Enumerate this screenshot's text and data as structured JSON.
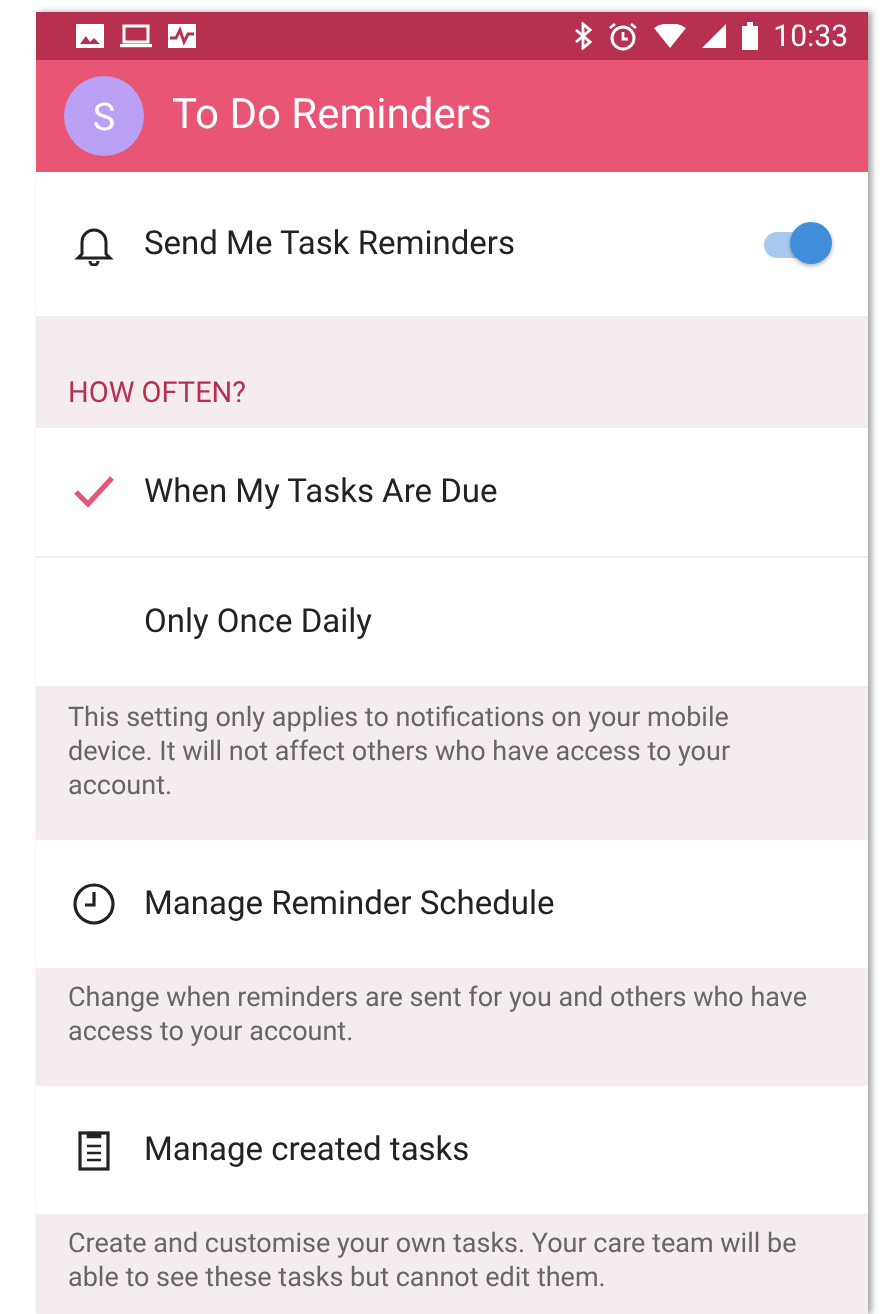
{
  "status_bar": {
    "time": "10:33"
  },
  "app_bar": {
    "avatar_letter": "S",
    "title": "To Do Reminders"
  },
  "rows": [
    {
      "kind": "toggle",
      "label": "Send Me Task Reminders",
      "on": true
    },
    {
      "kind": "header",
      "label": "HOW OFTEN?"
    },
    {
      "kind": "option",
      "label": "When My Tasks Are Due",
      "selected": true
    },
    {
      "kind": "option",
      "label": "Only Once Daily",
      "selected": false
    },
    {
      "kind": "note",
      "text": "This setting only applies to notifications on your mobile device. It will not affect others who have access to your account."
    },
    {
      "kind": "link",
      "label": "Manage Reminder Schedule"
    },
    {
      "kind": "note",
      "text": "Change when reminders are sent for you and others who have access to your account."
    },
    {
      "kind": "link",
      "label": "Manage created tasks"
    },
    {
      "kind": "note",
      "text": "Create and customise your own tasks. Your care team will be able to see these tasks but cannot edit them."
    }
  ]
}
